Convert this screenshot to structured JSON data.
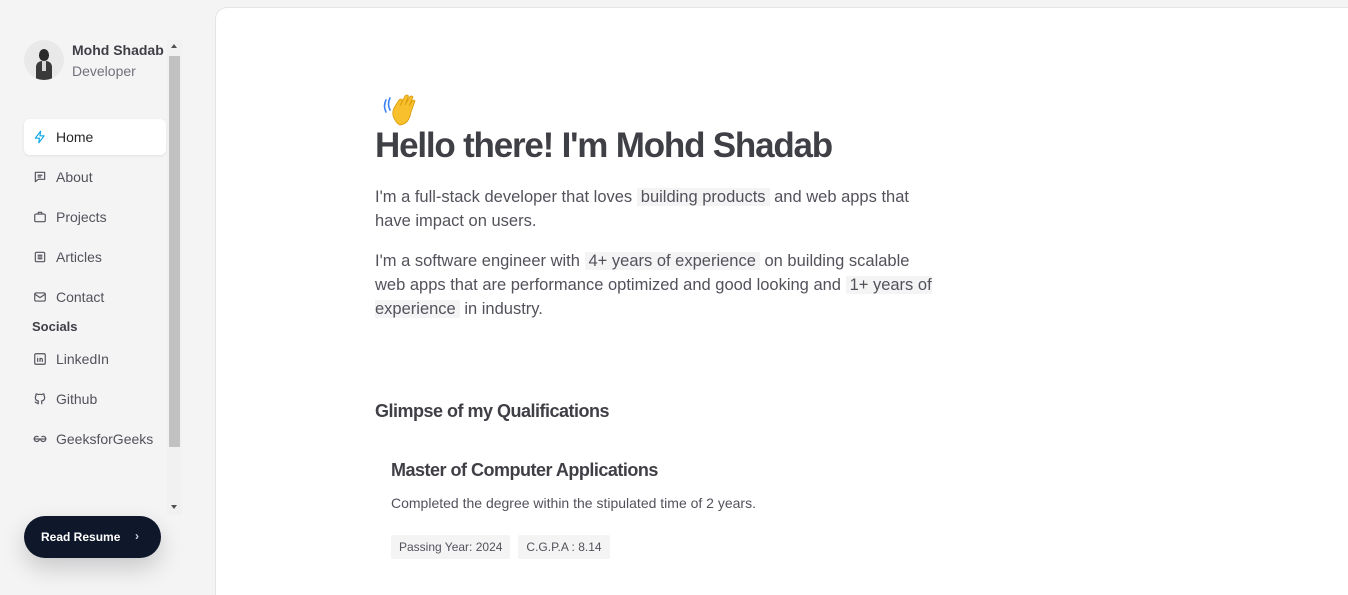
{
  "profile": {
    "name": "Mohd Shadab",
    "role": "Developer"
  },
  "nav": [
    {
      "label": "Home",
      "icon": "bolt-icon",
      "active": true
    },
    {
      "label": "About",
      "icon": "message-icon"
    },
    {
      "label": "Projects",
      "icon": "briefcase-icon"
    },
    {
      "label": "Articles",
      "icon": "document-icon"
    },
    {
      "label": "Contact",
      "icon": "mail-icon"
    }
  ],
  "socials": {
    "title": "Socials",
    "items": [
      {
        "label": "LinkedIn",
        "icon": "linkedin-icon"
      },
      {
        "label": "Github",
        "icon": "github-icon"
      },
      {
        "label": "GeeksforGeeks",
        "icon": "geeksforgeeks-icon"
      }
    ]
  },
  "resume": {
    "label": "Read Resume"
  },
  "hero": {
    "greeting": "Hello there! I'm Mohd Shadab",
    "p1_before": "I'm a full-stack developer that loves ",
    "p1_highlight": "building products",
    "p1_after": " and web apps that have impact on users.",
    "p2_before": "I'm a software engineer with ",
    "p2_highlight1": "4+ years of experience",
    "p2_mid": " on building scalable web apps that are performance optimized and good looking and ",
    "p2_highlight2": "1+ years of experience",
    "p2_after": " in industry."
  },
  "qualifications": {
    "title": "Glimpse of my Qualifications",
    "items": [
      {
        "degree": "Master of Computer Applications",
        "description": "Completed the degree within the stipulated time of 2 years.",
        "tags": [
          "Passing Year: 2024",
          "C.G.P.A : 8.14"
        ]
      }
    ]
  },
  "colors": {
    "accent": "#0ea5e9",
    "button_bg": "#0f172a"
  }
}
